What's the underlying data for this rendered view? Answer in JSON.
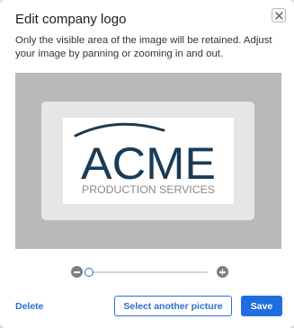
{
  "dialog": {
    "title": "Edit company logo",
    "description": "Only the visible area of the image will be retained. Adjust your image by panning or zooming in and out.",
    "close_icon": "close-icon"
  },
  "logo": {
    "main_text": "ACME",
    "sub_text": "PRODUCTION SERVICES",
    "colors": {
      "main": "#1a3b57",
      "sub": "#8a8a8a"
    }
  },
  "zoom": {
    "zoom_out_icon": "minus-circle-icon",
    "zoom_in_icon": "plus-circle-icon",
    "level": 0
  },
  "actions": {
    "delete_label": "Delete",
    "select_label": "Select another picture",
    "save_label": "Save"
  },
  "colors": {
    "accent": "#1f6ee0",
    "canvas_bg": "#b9b9b9",
    "crop_frame": "#e6e6e6"
  }
}
